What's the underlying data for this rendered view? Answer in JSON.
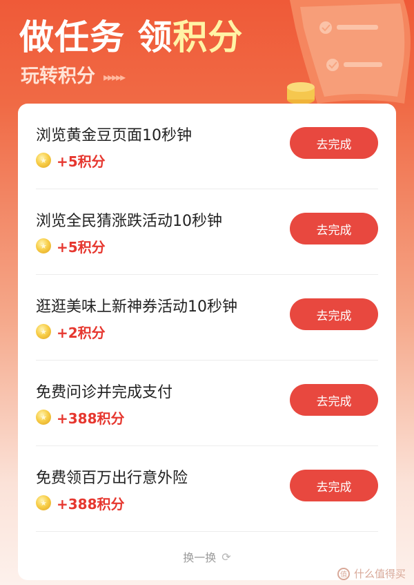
{
  "header": {
    "title_part1": "做任务 领",
    "title_highlight": "积分",
    "subtitle": "玩转积分",
    "subtitle_arrows": "▸▸▸▸▸"
  },
  "tasks": [
    {
      "title": "浏览黄金豆页面10秒钟",
      "reward": "+5积分",
      "button": "去完成"
    },
    {
      "title": "浏览全民猜涨跌活动10秒钟",
      "reward": "+5积分",
      "button": "去完成"
    },
    {
      "title": "逛逛美味上新神券活动10秒钟",
      "reward": "+2积分",
      "button": "去完成"
    },
    {
      "title": "免费问诊并完成支付",
      "reward": "+388积分",
      "button": "去完成"
    },
    {
      "title": "免费领百万出行意外险",
      "reward": "+388积分",
      "button": "去完成"
    }
  ],
  "refresh_label": "换一换",
  "watermark": "什么值得买",
  "colors": {
    "accent": "#e8483f",
    "reward_text": "#e6372f",
    "title_highlight": "#fff3a6"
  },
  "icons": {
    "coin": "star-coin-icon",
    "refresh": "refresh-icon"
  }
}
